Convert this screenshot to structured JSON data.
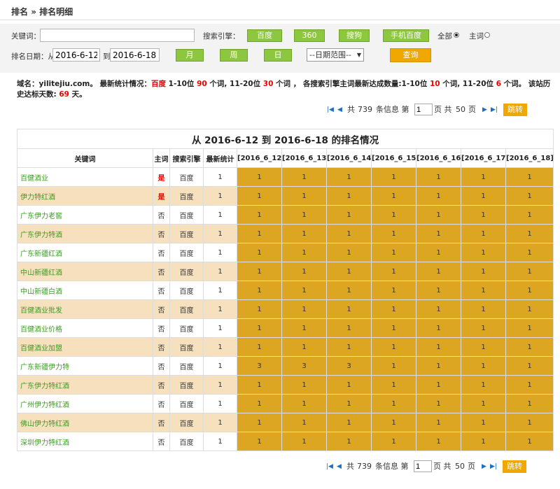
{
  "breadcrumb": {
    "root": "排名",
    "sep": "»",
    "current": "排名明细"
  },
  "filter": {
    "keyword_label": "关键词：",
    "keyword_value": "",
    "engine_label": "搜索引擎：",
    "engines": [
      "百度",
      "360",
      "搜狗",
      "手机百度"
    ],
    "scope_all": "全部",
    "scope_main": "主词",
    "date_label": "排名日期：从",
    "date_from": "2016-6-12",
    "date_to_label": "到",
    "date_to": "2016-6-18",
    "period_buttons": [
      "月",
      "周",
      "日"
    ],
    "date_range_select": "--日期范围--",
    "query_button": "查询"
  },
  "summary": {
    "domain_label": "域名：",
    "domain": "yilitejiu.com",
    "latest_label": "。 最新统计情况：",
    "engine": "百度",
    "top10_label": "1-10位",
    "top10": "90",
    "words1": "个词,",
    "top20_label": "11-20位",
    "top20": "30",
    "words2": "个词 ， 各搜索引擎主词最新达成数量:1-10位",
    "main_top10": "10",
    "words3": "个词, 11-20位",
    "main_top20": "6",
    "words4": "个词。 该站历史达标天数:",
    "days": "69",
    "days_unit": "天。"
  },
  "pager": {
    "total_prefix": "共",
    "total": "739",
    "total_suffix": "条信息 第",
    "page": "1",
    "pages_label": "页 共",
    "pages": "50",
    "pages_suffix": "页",
    "jump": "跳转"
  },
  "table": {
    "title": "从 2016-6-12 到 2016-6-18 的排名情况",
    "headers": [
      "关键词",
      "主词",
      "搜索引擎",
      "最新统计",
      "[2016_6_12]",
      "[2016_6_13]",
      "[2016_6_14]",
      "[2016_6_15]",
      "[2016_6_16]",
      "[2016_6_17]",
      "[2016_6_18]"
    ],
    "rows": [
      {
        "kw": "百健酒业",
        "main": "是",
        "engine": "百度",
        "latest": "1",
        "days": [
          "1",
          "1",
          "1",
          "1",
          "1",
          "1",
          "1"
        ]
      },
      {
        "kw": "伊力特红酒",
        "main": "是",
        "engine": "百度",
        "latest": "1",
        "days": [
          "1",
          "1",
          "1",
          "1",
          "1",
          "1",
          "1"
        ]
      },
      {
        "kw": "广东伊力老窖",
        "main": "否",
        "engine": "百度",
        "latest": "1",
        "days": [
          "1",
          "1",
          "1",
          "1",
          "1",
          "1",
          "1"
        ]
      },
      {
        "kw": "广东伊力特酒",
        "main": "否",
        "engine": "百度",
        "latest": "1",
        "days": [
          "1",
          "1",
          "1",
          "1",
          "1",
          "1",
          "1"
        ]
      },
      {
        "kw": "广东新疆红酒",
        "main": "否",
        "engine": "百度",
        "latest": "1",
        "days": [
          "1",
          "1",
          "1",
          "1",
          "1",
          "1",
          "1"
        ]
      },
      {
        "kw": "中山新疆红酒",
        "main": "否",
        "engine": "百度",
        "latest": "1",
        "days": [
          "1",
          "1",
          "1",
          "1",
          "1",
          "1",
          "1"
        ]
      },
      {
        "kw": "中山新疆白酒",
        "main": "否",
        "engine": "百度",
        "latest": "1",
        "days": [
          "1",
          "1",
          "1",
          "1",
          "1",
          "1",
          "1"
        ]
      },
      {
        "kw": "百健酒业批发",
        "main": "否",
        "engine": "百度",
        "latest": "1",
        "days": [
          "1",
          "1",
          "1",
          "1",
          "1",
          "1",
          "1"
        ]
      },
      {
        "kw": "百健酒业价格",
        "main": "否",
        "engine": "百度",
        "latest": "1",
        "days": [
          "1",
          "1",
          "1",
          "1",
          "1",
          "1",
          "1"
        ]
      },
      {
        "kw": "百健酒业加盟",
        "main": "否",
        "engine": "百度",
        "latest": "1",
        "days": [
          "1",
          "1",
          "1",
          "1",
          "1",
          "1",
          "1"
        ]
      },
      {
        "kw": "广东新疆伊力特",
        "main": "否",
        "engine": "百度",
        "latest": "1",
        "days": [
          "3",
          "3",
          "3",
          "1",
          "1",
          "1",
          "1"
        ]
      },
      {
        "kw": "广东伊力特红酒",
        "main": "否",
        "engine": "百度",
        "latest": "1",
        "days": [
          "1",
          "1",
          "1",
          "1",
          "1",
          "1",
          "1"
        ]
      },
      {
        "kw": "广州伊力特红酒",
        "main": "否",
        "engine": "百度",
        "latest": "1",
        "days": [
          "1",
          "1",
          "1",
          "1",
          "1",
          "1",
          "1"
        ]
      },
      {
        "kw": "佛山伊力特红酒",
        "main": "否",
        "engine": "百度",
        "latest": "1",
        "days": [
          "1",
          "1",
          "1",
          "1",
          "1",
          "1",
          "1"
        ]
      },
      {
        "kw": "深圳伊力特红酒",
        "main": "否",
        "engine": "百度",
        "latest": "1",
        "days": [
          "1",
          "1",
          "1",
          "1",
          "1",
          "1",
          "1"
        ]
      }
    ]
  },
  "colors": {
    "green_button": "#8dc63f",
    "orange_button": "#f0a800",
    "day_cell": "#dca622",
    "alt_row": "#f6e0bd",
    "keyword_link": "#3a9d23"
  }
}
